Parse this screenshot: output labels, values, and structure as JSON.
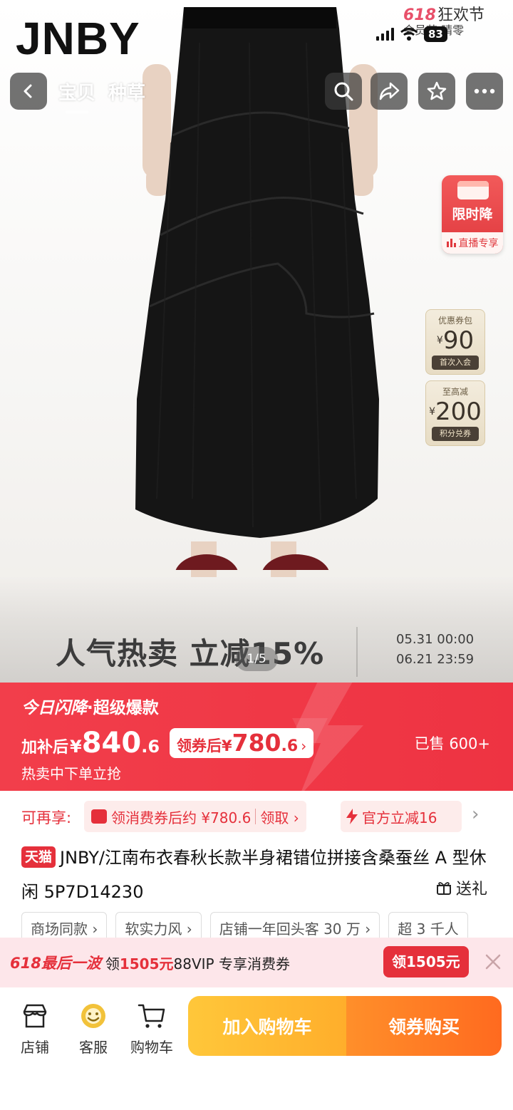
{
  "status_bar": {
    "promo_618": "618",
    "promo_festival": "狂欢节",
    "promo_line2": "会员节·晴零",
    "battery": "83"
  },
  "brand": {
    "logo_text": "JNBY"
  },
  "nav": {
    "tabs": [
      {
        "label": "宝贝",
        "active": true
      },
      {
        "label": "种草",
        "active": false
      }
    ],
    "icons": [
      "back-icon",
      "search-icon",
      "share-icon",
      "star-icon",
      "more-icon"
    ]
  },
  "side_badges": {
    "flash": {
      "title": "限时降",
      "sub": "直播专享"
    },
    "coupon_pack": {
      "label": "优惠券包",
      "currency": "¥",
      "value": "90",
      "foot": "首次入会"
    },
    "max_discount": {
      "label": "至高减",
      "currency": "¥",
      "value": "200",
      "foot": "积分兑券"
    }
  },
  "hero": {
    "banner_text": "人气热卖 立减15%",
    "date_start": "05.31 00:00",
    "date_end": "06.21 23:59",
    "page_indicator": "1/5"
  },
  "price_banner": {
    "title_main": "今日闪降",
    "title_sub": "·超级爆款",
    "after_subsidy_label": "加补后",
    "currency": "¥",
    "after_subsidy_int": "840",
    "after_subsidy_dec": ".6",
    "coupon_label": "领券后",
    "coupon_int": "780",
    "coupon_dec": ".6",
    "coupon_arrow": "›",
    "sold": "已售 600+",
    "hint": "热卖中下单立抢"
  },
  "discounts": {
    "label": "可再享:",
    "chip1_text": "领消费券后约 ¥780.6",
    "chip1_action": "领取 ›",
    "chip2_text": "官方立减16",
    "more": "›"
  },
  "product": {
    "platform": "天猫",
    "title": "JNBY/江南布衣春秋长款半身裙错位拼接含桑蚕丝 A 型休闲 5P7D14230",
    "gift": "送礼"
  },
  "tags": [
    "商场同款 ›",
    "软实力风 ›",
    "店铺一年回头客 30 万 ›",
    "超 3 千人"
  ],
  "promo618": {
    "logo": "618最后一波",
    "prefix": "领",
    "amount": "1505元",
    "suffix": "88VIP 专享消费券",
    "button": "领1505元"
  },
  "bottom_bar": {
    "store": "店铺",
    "service": "客服",
    "cart": "购物车",
    "add_to_cart": "加入购物车",
    "buy": "领券购买"
  },
  "colors": {
    "accent_red": "#ee3342",
    "cart_yellow": "#ffbb33",
    "buy_orange": "#ff7a22"
  }
}
